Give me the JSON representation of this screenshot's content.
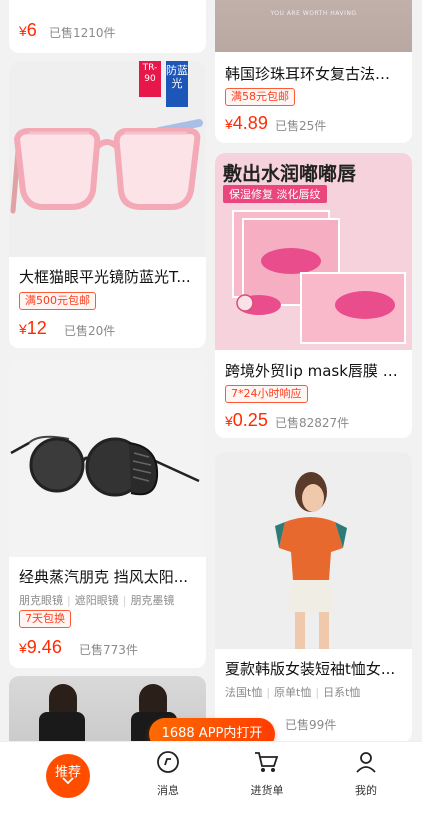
{
  "cards": {
    "l0": {
      "price_currency": "¥",
      "price": "6",
      "sold": "已售1210件"
    },
    "l1": {
      "title": "大框猫眼平光镜防蓝光T...",
      "tag": "满500元包邮",
      "price_currency": "¥",
      "price": "12",
      "sold": "已售20件",
      "badge1": "TR-90",
      "badge2": "防蓝光"
    },
    "l2": {
      "title": "经典蒸汽朋克 挡风太阳...",
      "attrs": [
        "朋克眼镜",
        "遮阳眼镜",
        "朋克墨镜"
      ],
      "tag": "7天包换",
      "price_currency": "¥",
      "price": "9.46",
      "sold": "已售773件"
    },
    "r0": {
      "img_text": "YOU ARE WORTH HAVING",
      "title": "韩国珍珠耳环女复古法式...",
      "tag": "满58元包邮",
      "price_currency": "¥",
      "price": "4.89",
      "sold": "已售25件"
    },
    "r1": {
      "img_headline": "敷出水润嘟嘟唇",
      "img_sub": "保湿修复 淡化唇纹",
      "title": "跨境外贸lip mask唇膜 去...",
      "tag": "7*24小时响应",
      "price_currency": "¥",
      "price": "0.25",
      "sold": "已售82827件"
    },
    "r2": {
      "title": "夏款韩版女装短袖t恤女...",
      "attrs": [
        "法国t恤",
        "原单t恤",
        "日系t恤"
      ],
      "sold": "已售99件"
    }
  },
  "open_app": "1688 APP内打开",
  "nav": {
    "recommend": "推荐",
    "messages": "消息",
    "cart": "进货单",
    "mine": "我的"
  },
  "colors": {
    "accent": "#ff4d00",
    "price": "#ff2a00"
  }
}
